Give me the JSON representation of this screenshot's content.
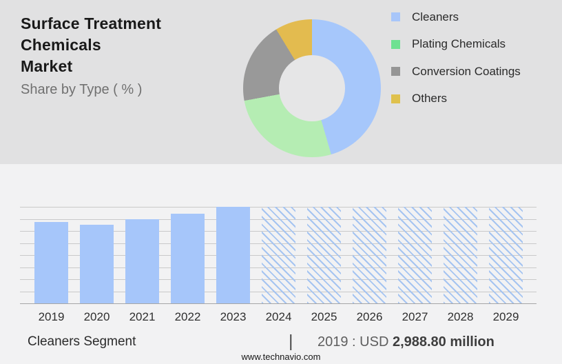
{
  "header": {
    "title_line1": "Surface Treatment Chemicals",
    "title_line2": "Market",
    "subtitle": "Share by Type ( % )"
  },
  "colors": {
    "top_panel_bg": "#e1e1e2",
    "bottom_panel_bg": "#f2f2f3",
    "donut_hole": "#e6e6e7",
    "bar_solid": "#a6c6fa",
    "hatch_line": "#a5c4f1",
    "gridline": "#c9c9c9",
    "axis_line": "#a6a6a6"
  },
  "chart_data": [
    {
      "type": "pie",
      "donut": true,
      "title": "Share by Type ( % )",
      "legend_position": "right",
      "labels": [
        "Cleaners",
        "Plating Chemicals",
        "Conversion Coatings",
        "Others"
      ],
      "values_pct": [
        45.5,
        26.6,
        19.2,
        8.7
      ],
      "slice_colors": [
        "#a6c7fb",
        "#b5edb3",
        "#999999",
        "#e3bb4f"
      ],
      "legend_colors": [
        "#a8c6fa",
        "#6ee191",
        "#959595",
        "#dfc14d"
      ]
    },
    {
      "type": "bar",
      "categories": [
        "2019",
        "2020",
        "2021",
        "2022",
        "2023",
        "2024",
        "2025",
        "2026",
        "2027",
        "2028",
        "2029"
      ],
      "values_pct_of_plot": [
        84.5,
        81.4,
        87.4,
        93.1,
        100,
        100,
        100,
        100,
        100,
        100,
        100
      ],
      "forecast_from_index": 5,
      "grid": true,
      "gridline_count": 9,
      "y_axis_labels_shown": false,
      "annotation": {
        "segment_label": "Cleaners Segment",
        "separator": "|",
        "value_prefix": "2019 : USD",
        "value_bold": "2,988.80 million"
      }
    }
  ],
  "footer": {
    "website": "www.technavio.com"
  }
}
